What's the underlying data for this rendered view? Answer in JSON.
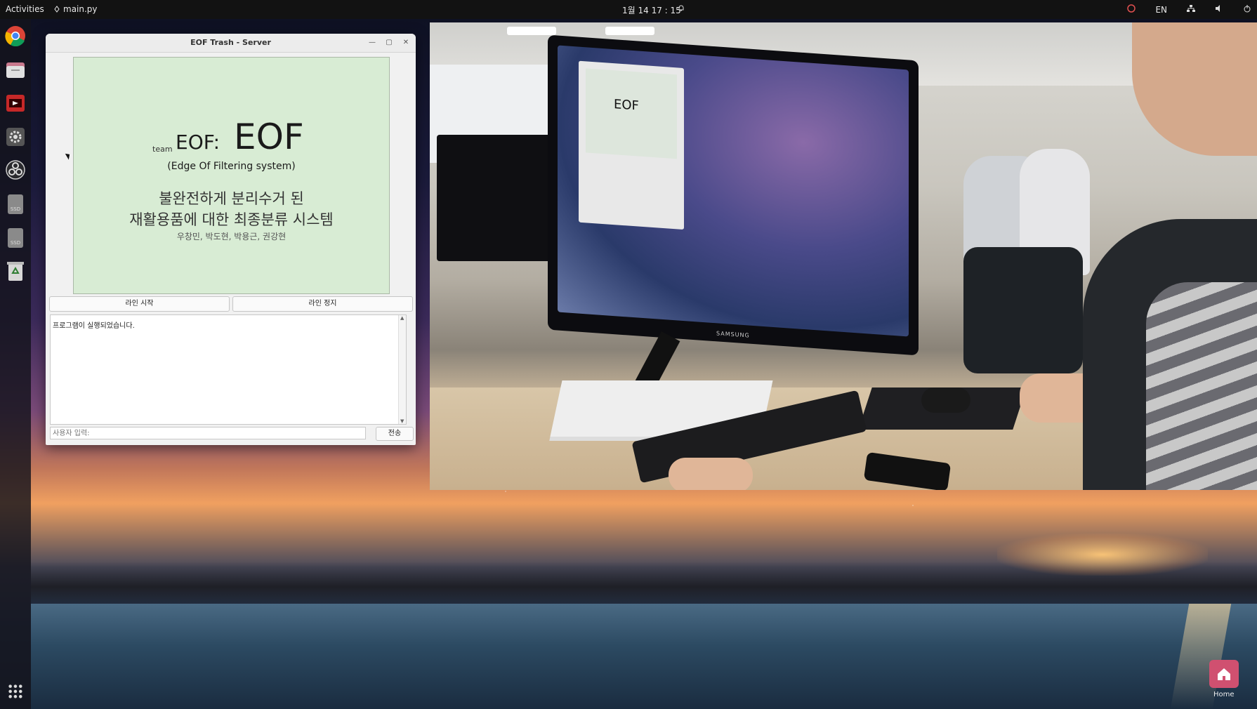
{
  "topbar": {
    "activities": "Activities",
    "app_name": "main.py",
    "clock": "1월 14  17 : 15",
    "lang": "EN"
  },
  "window": {
    "title": "EOF Trash - Server",
    "splash": {
      "team": "team",
      "eof_small": "EOF:",
      "eof_big": "EOF",
      "subtitle": "(Edge Of Filtering system)",
      "korean_line1": "불완전하게 분리수거 된",
      "korean_line2": "재활용품에 대한 최종분류 시스템",
      "names": "우창민, 박도현, 박용근, 권강현"
    },
    "buttons": {
      "start": "라인 시작",
      "stop": "라인 정지"
    },
    "log_text": "프로그램이 실행되었습니다.",
    "input_placeholder": "사용자 입력:",
    "send": "전송"
  },
  "video": {
    "mini_eof": "EOF",
    "brand": "SAMSUNG"
  },
  "desktop": {
    "home_label": "Home"
  },
  "colors": {
    "splash_bg": "#d8ecd4",
    "topbar_bg": "#121212",
    "dock_bg": "#14141c"
  },
  "dock_icons": [
    "chrome-icon",
    "files-icon",
    "media-icon",
    "settings-icon",
    "obs-icon",
    "ssd-icon",
    "ssd-icon",
    "trash-icon"
  ]
}
